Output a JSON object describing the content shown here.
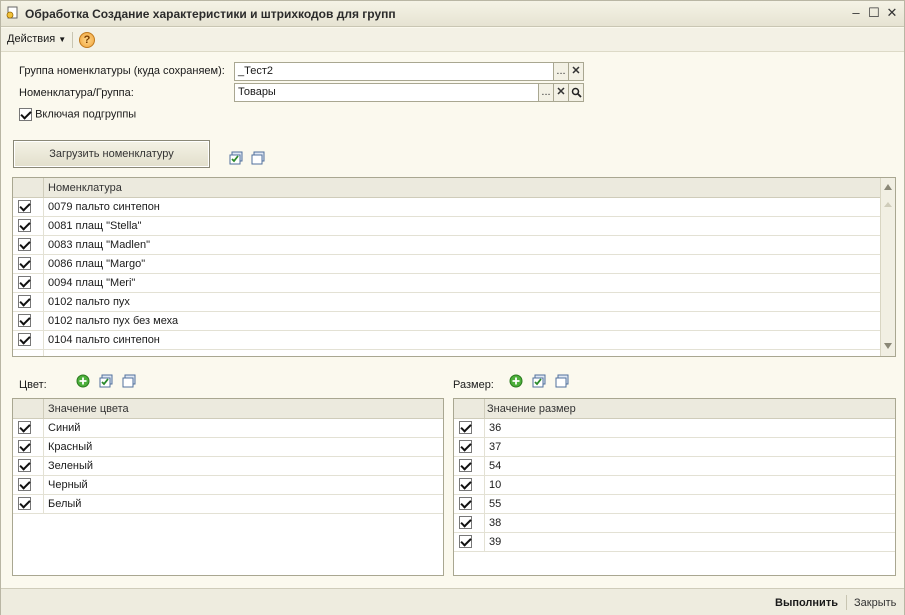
{
  "window": {
    "title": "Обработка  Создание характеристики и штрихкодов для групп",
    "icons": {
      "app": "processing-icon",
      "minimize": "minimize-icon",
      "maximize": "maximize-icon",
      "close": "close-icon"
    }
  },
  "toolbar": {
    "actions_label": "Действия",
    "help_icon": "help-icon",
    "help_glyph": "?"
  },
  "form": {
    "group_label": "Группа номенклатуры (куда сохраняем):",
    "group_value": "_Тест2",
    "nomenclature_label": "Номенклатура/Группа:",
    "nomenclature_value": "Товары",
    "include_subgroups_label": "Включая подгруппы",
    "include_subgroups_checked": true,
    "load_button_label": "Загрузить номенклатуру",
    "select_button_glyph": "...",
    "clear_button_glyph": "✕",
    "search_icon": "search-icon"
  },
  "nomenclature_table": {
    "header": "Номенклатура",
    "rows": [
      {
        "checked": true,
        "name": "0079 пальто синтепон"
      },
      {
        "checked": true,
        "name": "0081 плащ \"Stella\""
      },
      {
        "checked": true,
        "name": "0083 плащ \"Madlen\""
      },
      {
        "checked": true,
        "name": "0086 плащ \"Margo\""
      },
      {
        "checked": true,
        "name": "0094 плащ \"Meri\""
      },
      {
        "checked": true,
        "name": "0102 пальто пух"
      },
      {
        "checked": true,
        "name": "0102 пальто пух без меха"
      },
      {
        "checked": true,
        "name": "0104 пальто синтепон"
      }
    ]
  },
  "color_section": {
    "label": "Цвет:",
    "header": "Значение цвета",
    "rows": [
      {
        "checked": true,
        "value": "Синий"
      },
      {
        "checked": true,
        "value": "Красный"
      },
      {
        "checked": true,
        "value": "Зеленый"
      },
      {
        "checked": true,
        "value": "Черный"
      },
      {
        "checked": true,
        "value": "Белый"
      }
    ]
  },
  "size_section": {
    "label": "Размер:",
    "header": "Значение размер",
    "rows": [
      {
        "checked": true,
        "value": "36"
      },
      {
        "checked": true,
        "value": "37"
      },
      {
        "checked": true,
        "value": "54"
      },
      {
        "checked": true,
        "value": "10"
      },
      {
        "checked": true,
        "value": "55"
      },
      {
        "checked": true,
        "value": "38"
      },
      {
        "checked": true,
        "value": "39"
      }
    ]
  },
  "footer": {
    "execute_label": "Выполнить",
    "close_label": "Закрыть"
  },
  "colors": {
    "background": "#fbf9ee",
    "border": "#a9a791",
    "header": "#eceade"
  }
}
